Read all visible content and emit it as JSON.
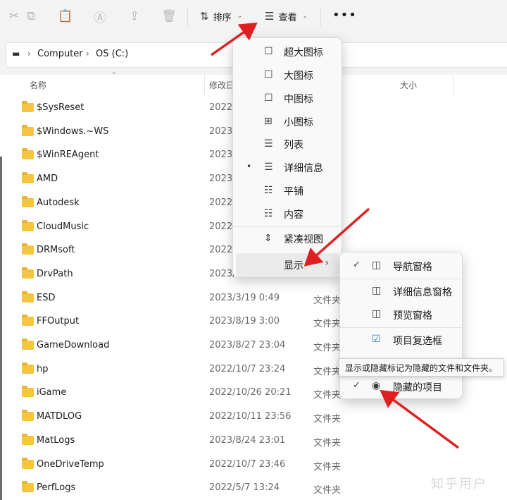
{
  "toolbar": {
    "sort_label": "排序",
    "view_label": "查看"
  },
  "address": {
    "computer": "Computer",
    "drive": "OS (C:)"
  },
  "columns": {
    "name": "名称",
    "modified": "修改日",
    "size": "大小"
  },
  "files": [
    {
      "name": "$SysReset",
      "date": "2022/",
      "type": ""
    },
    {
      "name": "$Windows.~WS",
      "date": "2023/",
      "type": ""
    },
    {
      "name": "$WinREAgent",
      "date": "2023/",
      "type": ""
    },
    {
      "name": "AMD",
      "date": "2023/",
      "type": ""
    },
    {
      "name": "Autodesk",
      "date": "2022/",
      "type": ""
    },
    {
      "name": "CloudMusic",
      "date": "2022/",
      "type": ""
    },
    {
      "name": "DRMsoft",
      "date": "2022/",
      "type": ""
    },
    {
      "name": "DrvPath",
      "date": "2023/",
      "type": ""
    },
    {
      "name": "ESD",
      "date": "2023/3/19 0:49",
      "type": "文件夹"
    },
    {
      "name": "FFOutput",
      "date": "2023/8/19 3:00",
      "type": "文件夹"
    },
    {
      "name": "GameDownload",
      "date": "2023/8/27 23:04",
      "type": "文件夹"
    },
    {
      "name": "hp",
      "date": "2022/10/7 23:24",
      "type": "文件夹"
    },
    {
      "name": "iGame",
      "date": "2022/10/26 20:21",
      "type": "文件夹"
    },
    {
      "name": "MATDLOG",
      "date": "2022/10/11 23:56",
      "type": "文件夹"
    },
    {
      "name": "MatLogs",
      "date": "2023/8/24 23:01",
      "type": "文件夹"
    },
    {
      "name": "OneDriveTemp",
      "date": "2022/10/7 23:46",
      "type": "文件夹"
    },
    {
      "name": "PerfLogs",
      "date": "2022/5/7 13:24",
      "type": "文件夹"
    }
  ],
  "view_menu": {
    "items": [
      {
        "label": "超大图标",
        "icon": "☐"
      },
      {
        "label": "大图标",
        "icon": "☐"
      },
      {
        "label": "中图标",
        "icon": "☐"
      },
      {
        "label": "小图标",
        "icon": "⊞"
      },
      {
        "label": "列表",
        "icon": "☰"
      },
      {
        "label": "详细信息",
        "icon": "☰"
      },
      {
        "label": "平铺",
        "icon": "☷"
      },
      {
        "label": "内容",
        "icon": "☷"
      },
      {
        "label": "紧凑视图",
        "icon": "⇕"
      }
    ],
    "show_label": "显示",
    "selected_bullet": "•",
    "submenu_chevron": "›"
  },
  "show_submenu": {
    "items": [
      {
        "label": "导航窗格",
        "check": "✓",
        "icon": "◫"
      },
      {
        "label": "详细信息窗格",
        "check": "",
        "icon": "◫"
      },
      {
        "label": "预览窗格",
        "check": "",
        "icon": "◫"
      },
      {
        "label": "项目复选框",
        "check": "",
        "icon": "☑"
      },
      {
        "label": "隐藏的项目",
        "check": "✓",
        "icon": "◉"
      }
    ]
  },
  "tooltip": "显示或隐藏标记为隐藏的文件和文件夹。",
  "watermark": "知乎用户",
  "colors": {
    "folder": "#f5c542",
    "arrow": "#e02020",
    "checkbox_blue": "#1a73d9"
  }
}
